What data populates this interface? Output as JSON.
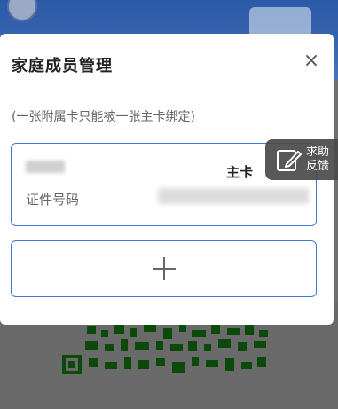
{
  "dialog": {
    "title": "家庭成员管理",
    "close_symbol": "×",
    "note": "(一张附属卡只能被一张主卡绑定)",
    "member_card": {
      "role": "主卡",
      "id_label": "证件号码"
    },
    "add_symbol": "+"
  },
  "help_button": {
    "line1": "求助",
    "line2": "反馈",
    "icon": "edit-icon"
  },
  "colors": {
    "accent_border": "#3a7bd5",
    "help_bg": "#4a4a4a",
    "header_bg": "#2b5aa8"
  }
}
